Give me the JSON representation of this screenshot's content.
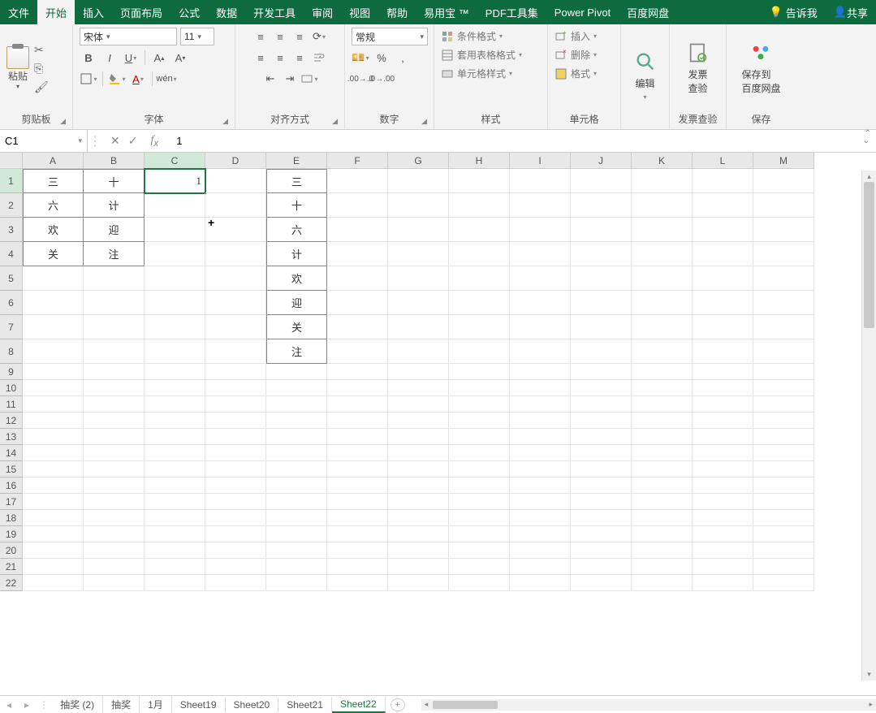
{
  "menu": {
    "items": [
      "文件",
      "开始",
      "插入",
      "页面布局",
      "公式",
      "数据",
      "开发工具",
      "审阅",
      "视图",
      "帮助",
      "易用宝 ™",
      "PDF工具集",
      "Power Pivot",
      "百度网盘"
    ],
    "active": "开始",
    "tellme": "告诉我",
    "share": "共享"
  },
  "ribbon": {
    "clipboard": {
      "paste": "粘贴",
      "label": "剪贴板"
    },
    "font": {
      "name": "宋体",
      "size": "11",
      "bold": "B",
      "italic": "I",
      "underline": "U",
      "label": "字体"
    },
    "align": {
      "label": "对齐方式"
    },
    "number": {
      "format": "常规",
      "label": "数字"
    },
    "styles": {
      "cond": "条件格式",
      "table": "套用表格格式",
      "cell": "单元格样式",
      "label": "样式"
    },
    "cells": {
      "insert": "插入",
      "delete": "删除",
      "format": "格式",
      "label": "单元格"
    },
    "edit": {
      "label_btn": "编辑"
    },
    "invoice": {
      "btn": "发票\n查验",
      "label": "发票查验"
    },
    "baidu": {
      "btn": "保存到\n百度网盘",
      "label": "保存"
    }
  },
  "fbar": {
    "name": "C1",
    "formula": "1"
  },
  "grid": {
    "cols": [
      "A",
      "B",
      "C",
      "D",
      "E",
      "F",
      "G",
      "H",
      "I",
      "J",
      "K",
      "L",
      "M"
    ],
    "rows": 22,
    "tallRows": [
      1,
      2,
      3,
      4,
      5,
      6,
      7,
      8
    ],
    "data": {
      "A1": "三",
      "B1": "十",
      "C1": "1",
      "E1": "三",
      "A2": "六",
      "B2": "计",
      "E2": "十",
      "A3": "欢",
      "B3": "迎",
      "E3": "六",
      "A4": "关",
      "B4": "注",
      "E4": "计",
      "E5": "欢",
      "E6": "迎",
      "E7": "关",
      "E8": "注"
    },
    "active": "C1"
  },
  "sheets": {
    "tabs": [
      "抽奖 (2)",
      "抽奖",
      "1月",
      "Sheet19",
      "Sheet20",
      "Sheet21",
      "Sheet22"
    ],
    "active": "Sheet22"
  }
}
